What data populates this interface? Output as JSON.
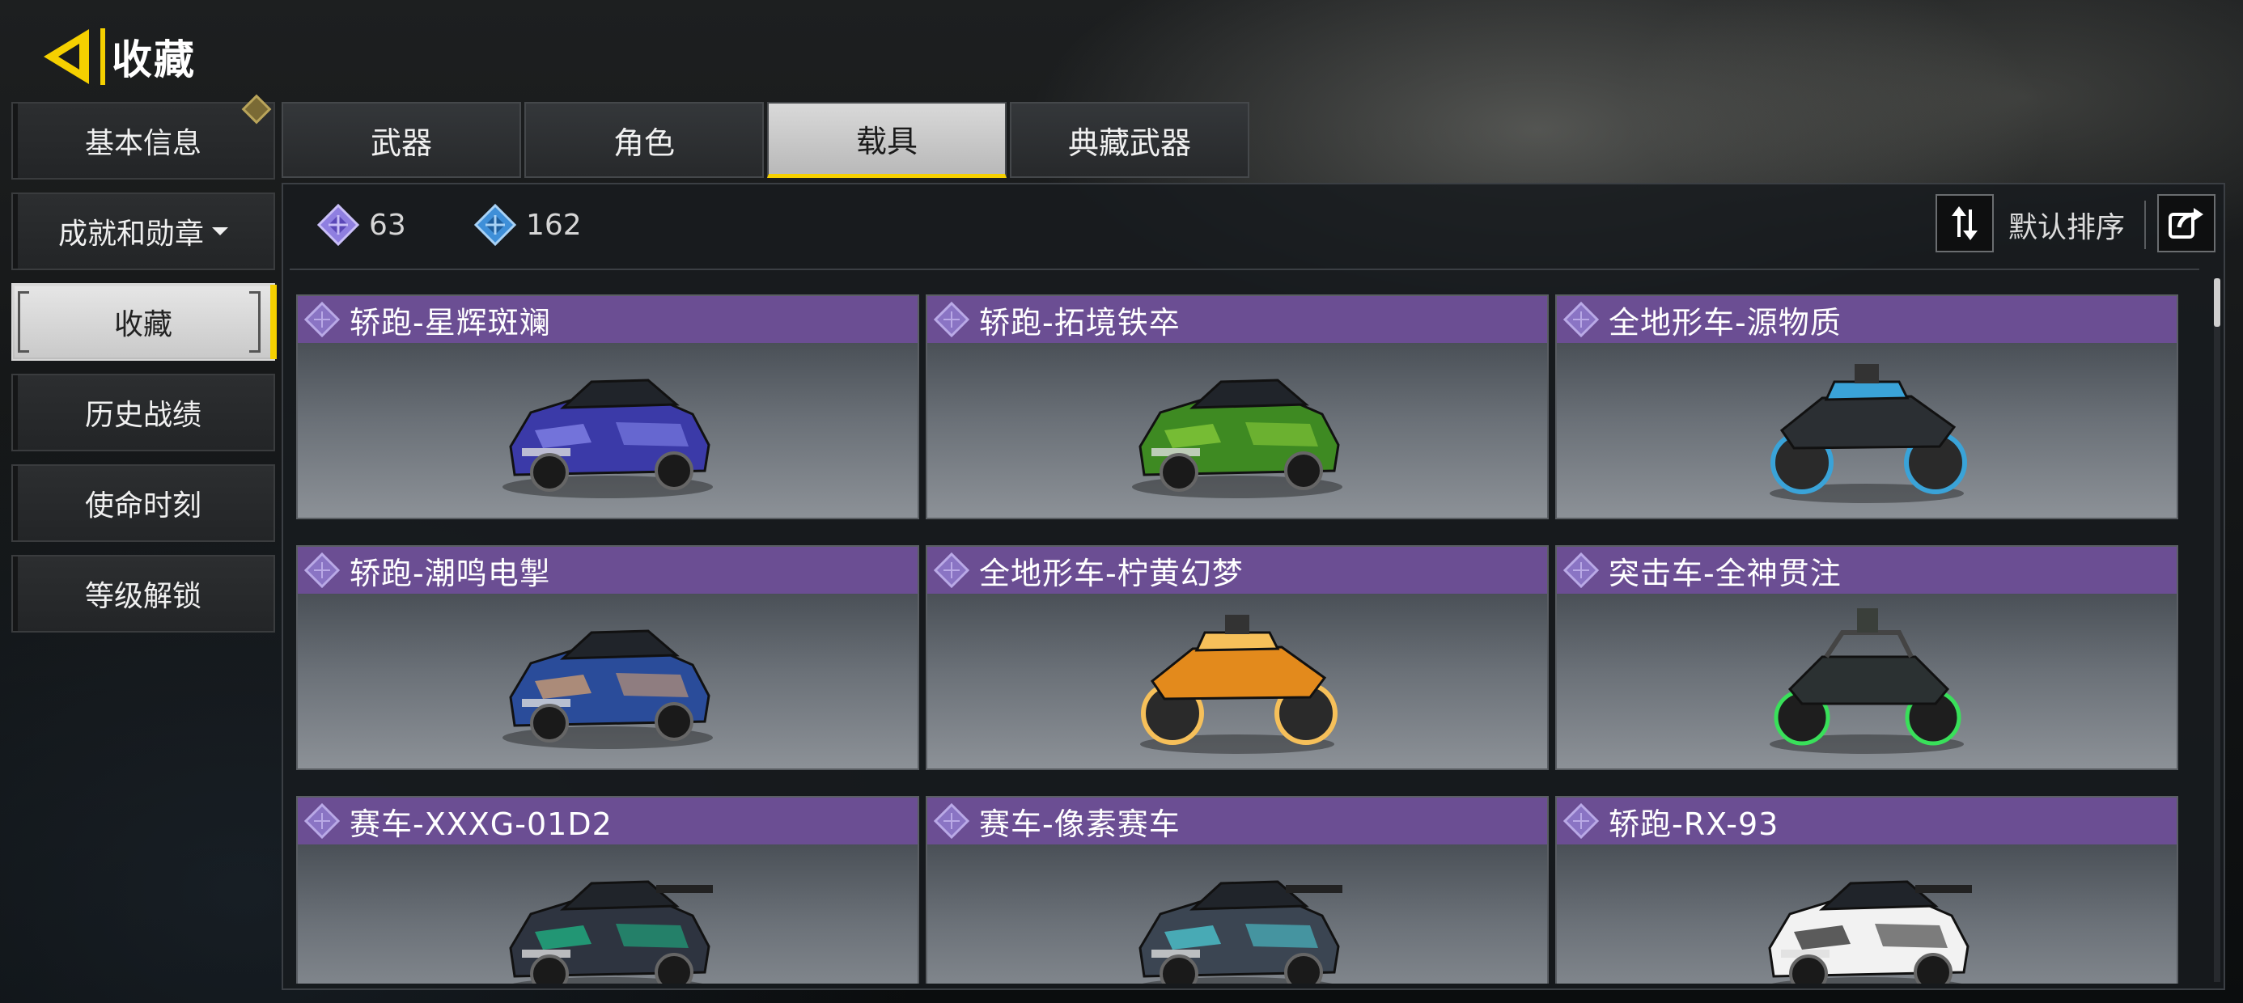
{
  "header": {
    "title": "收藏"
  },
  "sidenav": {
    "items": [
      {
        "label": "基本信息",
        "badge": true
      },
      {
        "label": "成就和勋章",
        "dropdown": true
      },
      {
        "label": "收藏",
        "active": true
      },
      {
        "label": "历史战绩"
      },
      {
        "label": "使命时刻"
      },
      {
        "label": "等级解锁"
      }
    ]
  },
  "tabs": [
    {
      "label": "武器"
    },
    {
      "label": "角色"
    },
    {
      "label": "载具",
      "active": true
    },
    {
      "label": "典藏武器"
    }
  ],
  "stats": {
    "purple_count": "63",
    "blue_count": "162"
  },
  "sort": {
    "label": "默认排序"
  },
  "cards": [
    {
      "name": "轿跑-星辉斑斓",
      "vehicle": "sedan",
      "color": "#3b3aa8",
      "accent": "#8b8cf0"
    },
    {
      "name": "轿跑-拓境铁卒",
      "vehicle": "sedan",
      "color": "#3e8a22",
      "accent": "#8fd23c"
    },
    {
      "name": "全地形车-源物质",
      "vehicle": "atv",
      "color": "#2b2f33",
      "accent": "#3aa3d8"
    },
    {
      "name": "轿跑-潮鸣电掣",
      "vehicle": "sedan",
      "color": "#2a4c9a",
      "accent": "#e2a66b"
    },
    {
      "name": "全地形车-柠黄幻梦",
      "vehicle": "atv",
      "color": "#e38a1c",
      "accent": "#f6c05a"
    },
    {
      "name": "突击车-全神贯注",
      "vehicle": "buggy",
      "color": "#2b3132",
      "accent": "#39e05a"
    },
    {
      "name": "赛车-XXXG-01D2",
      "vehicle": "race",
      "color": "#2e3440",
      "accent": "#1ec08a"
    },
    {
      "name": "赛车-像素赛车",
      "vehicle": "race",
      "color": "#3b4552",
      "accent": "#4fd6e0"
    },
    {
      "name": "轿跑-RX-93",
      "vehicle": "race",
      "color": "#f2f2f2",
      "accent": "#1b1b1b"
    }
  ]
}
